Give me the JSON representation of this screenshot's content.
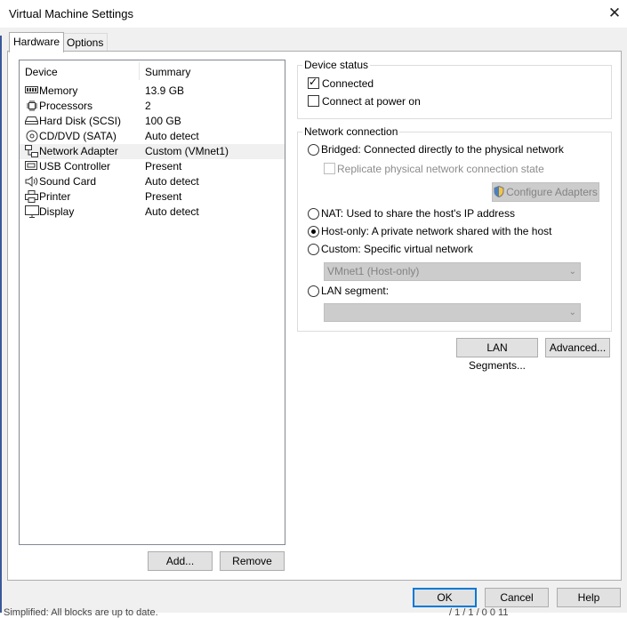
{
  "window": {
    "title": "Virtual Machine Settings"
  },
  "tabs": [
    {
      "label": "Hardware"
    },
    {
      "label": "Options"
    }
  ],
  "device_list": {
    "headers": {
      "device": "Device",
      "summary": "Summary"
    },
    "rows": [
      {
        "name": "Memory",
        "summary": "13.9 GB",
        "icon": "memory-icon"
      },
      {
        "name": "Processors",
        "summary": "2",
        "icon": "processor-icon"
      },
      {
        "name": "Hard Disk (SCSI)",
        "summary": "100 GB",
        "icon": "hard-disk-icon"
      },
      {
        "name": "CD/DVD (SATA)",
        "summary": "Auto detect",
        "icon": "cd-dvd-icon"
      },
      {
        "name": "Network Adapter",
        "summary": "Custom (VMnet1)",
        "icon": "network-adapter-icon",
        "selected": true
      },
      {
        "name": "USB Controller",
        "summary": "Present",
        "icon": "usb-icon"
      },
      {
        "name": "Sound Card",
        "summary": "Auto detect",
        "icon": "speaker-icon"
      },
      {
        "name": "Printer",
        "summary": "Present",
        "icon": "printer-icon"
      },
      {
        "name": "Display",
        "summary": "Auto detect",
        "icon": "monitor-icon"
      }
    ],
    "add_label": "Add...",
    "remove_label": "Remove"
  },
  "device_status": {
    "title": "Device status",
    "connected": {
      "label": "Connected",
      "checked": true
    },
    "connect_at_power_on": {
      "label": "Connect at power on",
      "checked": false
    }
  },
  "network_connection": {
    "title": "Network connection",
    "bridged": "Bridged: Connected directly to the physical network",
    "replicate": "Replicate physical network connection state",
    "configure_adapters": "Configure Adapters",
    "nat": "NAT: Used to share the host's IP address",
    "host_only": "Host-only: A private network shared with the host",
    "custom": "Custom: Specific virtual network",
    "custom_value": "VMnet1 (Host-only)",
    "lan_segment": "LAN segment:",
    "lan_segment_value": "",
    "selected": "host_only"
  },
  "buttons": {
    "lan_segments": "LAN Segments...",
    "advanced": "Advanced...",
    "ok": "OK",
    "cancel": "Cancel",
    "help": "Help"
  },
  "background_status": {
    "left": "Simplified: All blocks are up to date.",
    "right": "/ 1 / 1 / 0 0 11"
  },
  "colors": {
    "accent": "#0078d7",
    "selection": "#f0f0f0",
    "disabled": "#838383"
  }
}
